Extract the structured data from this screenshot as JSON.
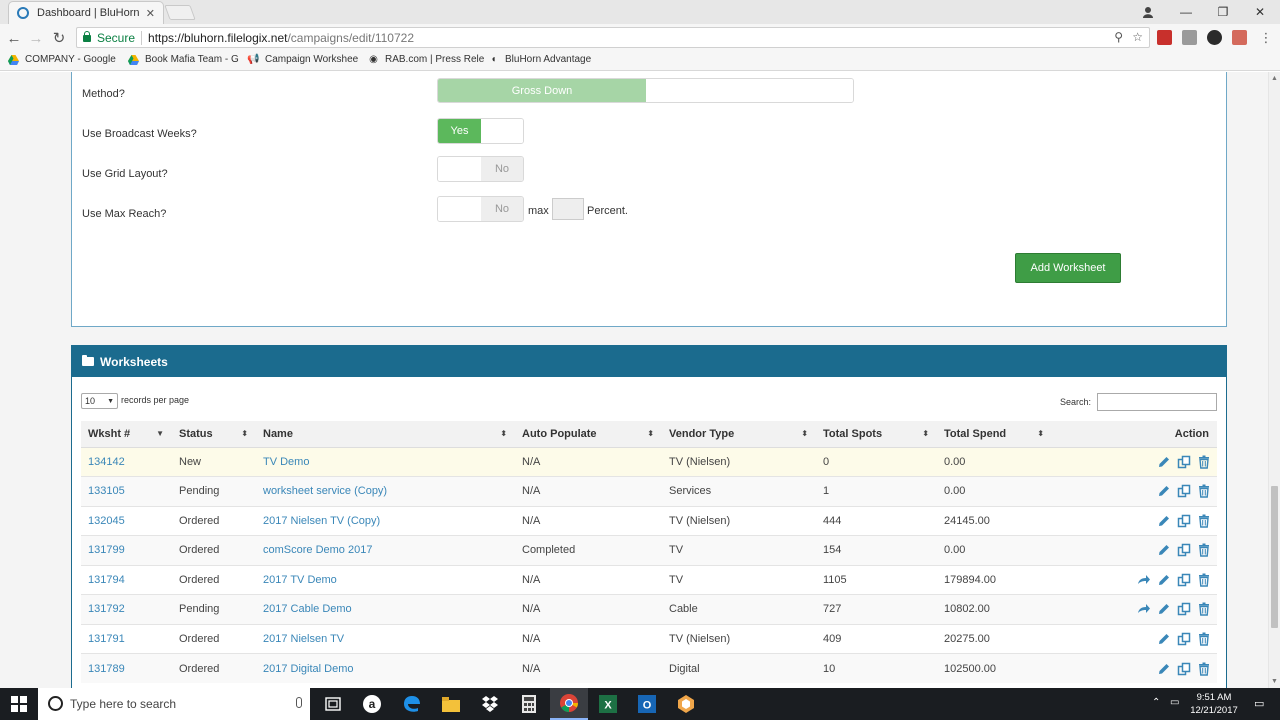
{
  "browser": {
    "tab_title": "Dashboard | BluHorn",
    "secure_label": "Secure",
    "url_host": "https://bluhorn.filelogix.net",
    "url_path": "/campaigns/edit/110722",
    "bookmarks": [
      {
        "label": "COMPANY - Google"
      },
      {
        "label": "Book Mafia Team - G"
      },
      {
        "label": "Campaign Workshee"
      },
      {
        "label": "RAB.com | Press Rele"
      },
      {
        "label": "BluHorn Advantage"
      }
    ]
  },
  "settings": {
    "method_label": "Method?",
    "method_value": "Gross Down",
    "broadcast_label": "Use Broadcast Weeks?",
    "broadcast_value": "Yes",
    "grid_label": "Use Grid Layout?",
    "grid_value": "No",
    "maxreach_label": "Use Max Reach?",
    "maxreach_value": "No",
    "max_text": "max",
    "percent_text": "Percent.",
    "add_button": "Add Worksheet"
  },
  "worksheets": {
    "title": "Worksheets",
    "records_per_page_value": "10",
    "records_per_page_label": "records per page",
    "search_label": "Search:",
    "columns": [
      "Wksht #",
      "Status",
      "Name",
      "Auto Populate",
      "Vendor Type",
      "Total Spots",
      "Total Spend",
      "Action"
    ],
    "rows": [
      {
        "id": "134142",
        "status": "New",
        "name": "TV Demo",
        "auto": "N/A",
        "vendor": "TV (Nielsen)",
        "spots": "0",
        "spend": "0.00"
      },
      {
        "id": "133105",
        "status": "Pending",
        "name": "worksheet service (Copy)",
        "auto": "N/A",
        "vendor": "Services",
        "spots": "1",
        "spend": "0.00"
      },
      {
        "id": "132045",
        "status": "Ordered",
        "name": "2017 Nielsen TV (Copy)",
        "auto": "N/A",
        "vendor": "TV (Nielsen)",
        "spots": "444",
        "spend": "24145.00"
      },
      {
        "id": "131799",
        "status": "Ordered",
        "name": "comScore Demo 2017",
        "auto": "Completed",
        "vendor": "TV",
        "spots": "154",
        "spend": "0.00"
      },
      {
        "id": "131794",
        "status": "Ordered",
        "name": "2017 TV Demo",
        "auto": "N/A",
        "vendor": "TV",
        "spots": "1105",
        "spend": "179894.00"
      },
      {
        "id": "131792",
        "status": "Pending",
        "name": "2017 Cable Demo",
        "auto": "N/A",
        "vendor": "Cable",
        "spots": "727",
        "spend": "10802.00"
      },
      {
        "id": "131791",
        "status": "Ordered",
        "name": "2017 Nielsen TV",
        "auto": "N/A",
        "vendor": "TV (Nielsen)",
        "spots": "409",
        "spend": "20275.00"
      },
      {
        "id": "131789",
        "status": "Ordered",
        "name": "2017 Digital Demo",
        "auto": "N/A",
        "vendor": "Digital",
        "spots": "10",
        "spend": "102500.00"
      }
    ]
  },
  "taskbar": {
    "search_placeholder": "Type here to search",
    "time": "9:51 AM",
    "date": "12/21/2017"
  },
  "colors": {
    "accent": "#1b6b8e",
    "success": "#5cb85c",
    "link": "#3a87b8"
  }
}
